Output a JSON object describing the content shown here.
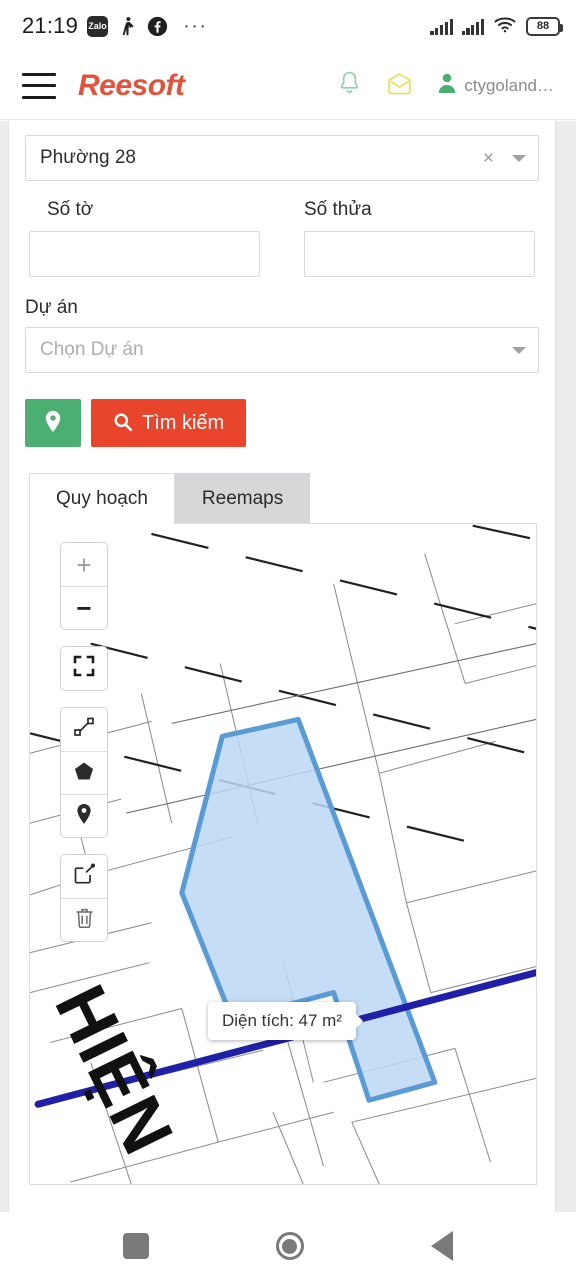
{
  "status_bar": {
    "time": "21:19",
    "zalo_label": "Zalo",
    "dots": "···",
    "battery_level": "88",
    "icons": [
      "zalo-icon",
      "person-walking-icon",
      "facebook-icon",
      "more-dots-icon",
      "signal-1-icon",
      "signal-2-icon",
      "wifi-icon",
      "battery-icon"
    ]
  },
  "header": {
    "brand": "Reesoft",
    "menu_icon": "hamburger-menu-icon",
    "bell_icon": "bell-icon",
    "mail_icon": "envelope-icon",
    "user_icon": "user-icon",
    "user_name": "ctygoland…"
  },
  "form": {
    "ward_select": {
      "value": "Phường 28",
      "clear": "×"
    },
    "so_to": {
      "label": "Số tờ",
      "value": "",
      "placeholder": ""
    },
    "so_thua": {
      "label": "Số thửa",
      "value": "",
      "placeholder": ""
    },
    "project": {
      "label": "Dự án",
      "placeholder": "Chọn Dự án"
    },
    "locate_button": {
      "label": "",
      "icon": "map-pin-icon",
      "color": "#4caf72"
    },
    "search_button": {
      "label": "Tìm kiếm",
      "icon": "search-icon",
      "color": "#e8452c"
    }
  },
  "tabs": [
    {
      "label": "Quy hoạch",
      "active": true
    },
    {
      "label": "Reemaps",
      "active": false
    }
  ],
  "map": {
    "controls": [
      {
        "name": "zoom-in",
        "glyph": "+"
      },
      {
        "name": "zoom-out",
        "glyph": "−"
      },
      {
        "name": "fullscreen",
        "glyph": "fullscreen-icon"
      },
      {
        "name": "draw-line",
        "glyph": "polyline-icon"
      },
      {
        "name": "draw-polygon",
        "glyph": "polygon-icon"
      },
      {
        "name": "draw-marker",
        "glyph": "map-pin-icon"
      },
      {
        "name": "edit-shape",
        "glyph": "edit-icon"
      },
      {
        "name": "delete-shape",
        "glyph": "trash-icon"
      }
    ],
    "tooltip": "Diện tích: 47 m²",
    "street_label": "HIỆN",
    "parcel_fill": "#bcd9f5",
    "parcel_stroke": "#5b9bd5",
    "route_color": "#1f1fa8"
  },
  "navbar": {
    "recents": "recents-square-icon",
    "home": "home-circle-icon",
    "back": "back-triangle-icon"
  }
}
